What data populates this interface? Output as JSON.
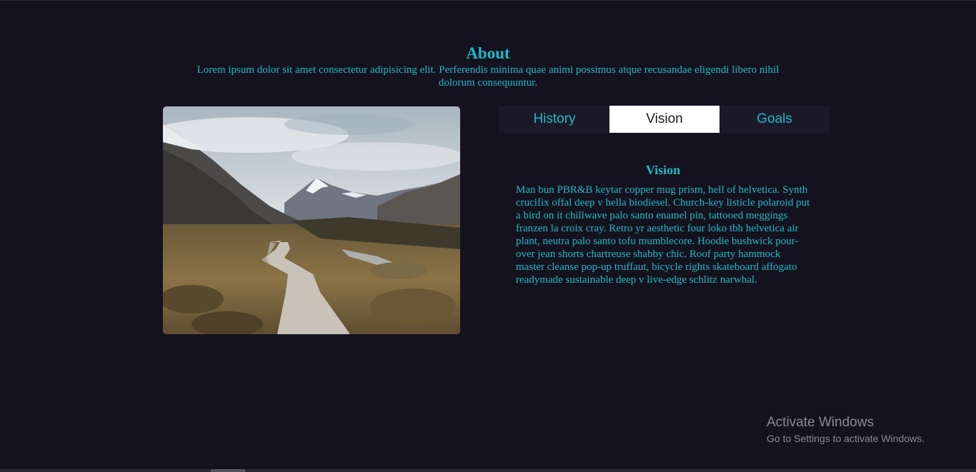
{
  "about": {
    "title": "About",
    "intro": "Lorem ipsum dolor sit amet consectetur adipisicing elit. Perferendis minima quae animi possimus atque recusandae eligendi libero nihil dolorum consequuntur."
  },
  "tabs": [
    {
      "label": "History",
      "active": false
    },
    {
      "label": "Vision",
      "active": true
    },
    {
      "label": "Goals",
      "active": false
    }
  ],
  "panel": {
    "title": "Vision",
    "text": "Man bun PBR&B keytar copper mug prism, hell of helvetica. Synth crucifix offal deep v hella biodiesel. Church-key listicle polaroid put a bird on it chillwave palo santo enamel pin, tattooed meggings franzen la croix cray. Retro yr aesthetic four loko tbh helvetica air plant, neutra palo santo tofu mumblecore. Hoodie bushwick pour-over jean shorts chartreuse shabby chic. Roof party hammock master cleanse pop-up truffaut, bicycle rights skateboard affogato readymade sustainable deep v live-edge schlitz narwhal."
  },
  "watermark": {
    "title": "Activate Windows",
    "subtitle": "Go to Settings to activate Windows."
  },
  "colors": {
    "background": "#15121f",
    "accent": "#1fb9c8",
    "tab_bar": "#1c1a29",
    "tab_active": "#ffffff"
  }
}
